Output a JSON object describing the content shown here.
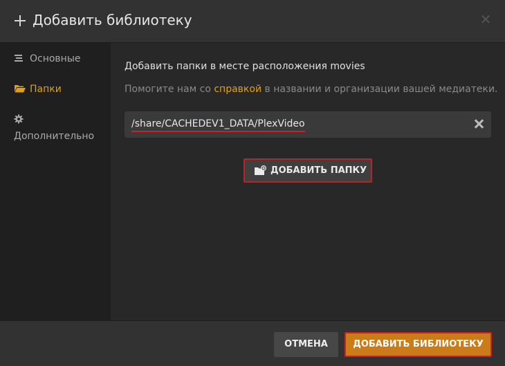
{
  "header": {
    "title": "Добавить библиотеку",
    "icon": "plus-icon",
    "close_icon": "close-icon"
  },
  "sidebar": {
    "items": [
      {
        "label": "Основные",
        "icon": "list-icon",
        "active": false
      },
      {
        "label": "Папки",
        "icon": "folder-open-icon",
        "active": true
      },
      {
        "label": "Дополнительно",
        "icon": "gear-icon",
        "active": false
      }
    ]
  },
  "content": {
    "heading": "Добавить папки в месте расположения movies",
    "help_before": "Помогите нам со ",
    "help_link": "справкой",
    "help_after": " в названии и организации вашей медиатеки.",
    "path_value": "/share/CACHEDEV1_DATA/PlexVideo",
    "add_folder_label": "ДОБАВИТЬ ПАПКУ"
  },
  "footer": {
    "cancel_label": "ОТМЕНА",
    "add_library_label": "ДОБАВИТЬ БИБЛИОТЕКУ"
  },
  "colors": {
    "accent": "#e5a00d",
    "primary_button": "#cc7b19",
    "highlight_red": "#c8232c"
  }
}
